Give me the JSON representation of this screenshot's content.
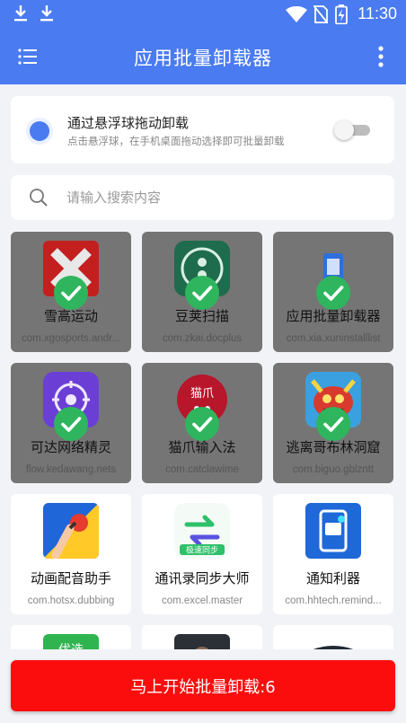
{
  "status_bar": {
    "time": "11:30"
  },
  "app_bar": {
    "title": "应用批量卸载器"
  },
  "float_uninstall": {
    "title": "通过悬浮球拖动卸载",
    "subtitle": "点击悬浮球，在手机桌面拖动选择即可批量卸载",
    "enabled": false
  },
  "search": {
    "placeholder": "请输入搜索内容",
    "value": ""
  },
  "apps": [
    {
      "name": "雪高运动",
      "package": "com.xgosports.andr...",
      "selected": true
    },
    {
      "name": "豆荚扫描",
      "package": "com.zkai.docplus",
      "selected": true
    },
    {
      "name": "应用批量卸载器",
      "package": "com.xia.xuninstalllist",
      "selected": true
    },
    {
      "name": "可达网络精灵",
      "package": "flow.kedawang.nets",
      "selected": true
    },
    {
      "name": "猫爪输入法",
      "package": "com.catclawime",
      "selected": true
    },
    {
      "name": "逃离哥布林洞窟",
      "package": "com.biguo.gblzntt",
      "selected": true
    },
    {
      "name": "动画配音助手",
      "package": "com.hotsx.dubbing",
      "selected": false
    },
    {
      "name": "通讯录同步大师",
      "package": "com.excel.master",
      "selected": false
    },
    {
      "name": "通知利器",
      "package": "com.hhtech.remind...",
      "selected": false
    },
    {
      "name": "",
      "package": "",
      "selected": false,
      "icon_text": "优选"
    },
    {
      "name": "",
      "package": "",
      "selected": false
    },
    {
      "name": "",
      "package": "",
      "selected": false
    }
  ],
  "icon_texts": {
    "qz": "极速同步",
    "cat": "猫爪",
    "youxuan": "优选"
  },
  "action_button": {
    "label": "马上开始批量卸载:6"
  },
  "colors": {
    "primary": "#4a7bf0",
    "danger": "#fb0d0d",
    "selected_overlay": "#757575",
    "check": "#2fb55d"
  }
}
